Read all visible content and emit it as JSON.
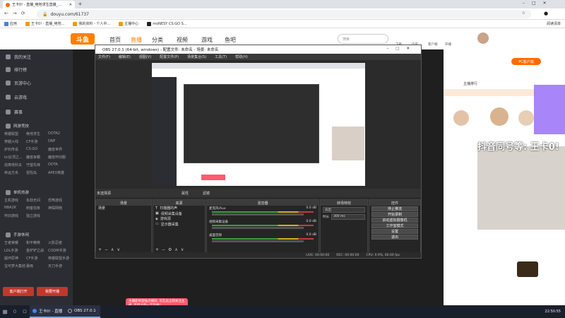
{
  "browser": {
    "tab_title": "王卡0! - 直播_绝地求生直播_...",
    "url": "douyu.com/61737",
    "bookmarks": [
      "应用",
      "王卡0! - 直播_绝地...",
      "我的资料 - 个人中...",
      "主播中心",
      "moNESY CS:GO S..."
    ],
    "bookmark_right": "阅读清单"
  },
  "site": {
    "logo": "斗鱼",
    "nav": [
      "首页",
      "直播",
      "分类",
      "视频",
      "游戏",
      "鱼吧"
    ],
    "search_placeholder": "搜索",
    "header_icons": [
      "下载",
      "历史",
      "客户端",
      "开播"
    ]
  },
  "sidebar": {
    "items": [
      "我的关注",
      "排行榜",
      "页游中心",
      "云游戏",
      "赛事"
    ],
    "sections": [
      {
        "title": "网游竞技",
        "links": [
          "英雄联盟",
          "绝地求生",
          "DOTA2",
          "穿越火线",
          "CF手游",
          "DNF",
          "炉石传说",
          "CS:GO",
          "魔兽世界",
          "lol云顶之...",
          "魔兽争霸",
          "魔兽怀旧服",
          "逃离塔科夫",
          "守望先锋",
          "DOTA",
          "命运方舟",
          "冒险岛",
          "APEX英雄"
        ]
      },
      {
        "title": "单机热游",
        "links": [
          "主机游戏",
          "永劫无间",
          "恐怖游戏",
          "NBA2K",
          "刺客信条",
          "神探网络",
          "怀旧游戏",
          "独立游戏"
        ]
      },
      {
        "title": "手游休闲",
        "links": [
          "王者荣耀",
          "和平精英",
          "火影忍者",
          "LOL手游",
          "金铲铲之战",
          "CODM手游",
          "崩坏原神",
          "CF手游",
          "英雄联盟手游",
          "宝可梦大集结",
          "暴雨",
          "天刀手游"
        ]
      }
    ],
    "buttons": [
      "客户端打开",
      "我要开播"
    ]
  },
  "obs": {
    "title": "OBS 27.0.1 (64-bit, windows) - 配置文件: 未命名 - 场景: 未命名",
    "menu": [
      "文件(F)",
      "编辑(E)",
      "视图(V)",
      "配置文件(P)",
      "场景集合(S)",
      "工具(T)",
      "帮助(H)"
    ],
    "toolbar_label": "未选择源",
    "toolbar_buttons": [
      "属性",
      "滤镜"
    ],
    "panels": {
      "scenes": {
        "title": "场景",
        "items": [
          "场景"
        ]
      },
      "sources": {
        "title": "来源",
        "items": [
          "扫描器的声",
          "视频采集设备",
          "游戏源",
          "显示器采集"
        ]
      },
      "mixer": {
        "title": "混音器",
        "channels": [
          {
            "name": "麦克风/Aux",
            "db": "0.0 dB"
          },
          {
            "name": "视频采集设备",
            "db": "0.0 dB"
          },
          {
            "name": "桌面音频",
            "db": "0.0 dB"
          }
        ]
      },
      "transitions": {
        "title": "转场特效",
        "type": "淡出",
        "duration_label": "时长",
        "duration": "300 ms"
      },
      "controls": {
        "title": "控件",
        "buttons": [
          "停止推流",
          "开始录制",
          "启动虚拟摄像机",
          "工作室模式",
          "设置",
          "退出"
        ]
      }
    },
    "status": [
      "LIVE: 00:00:00",
      "REC: 00:00:00",
      "CPU: 0.9%, 60.00 fps"
    ]
  },
  "stream": {
    "overlay_text": "抖音同号等: 王卡0!",
    "anchor_label": "主播排行",
    "pc_button": "PC客户端",
    "toast": "主播即将登陆点播间, 可在此立即关注主播, 不错过每一次开播!"
  },
  "taskbar": {
    "items": [
      "王卡0! - 直播_绝地求...",
      "OBS 27.0.1 (64-bit..."
    ],
    "clock": "22:50:55"
  },
  "colors": {
    "accent": "#ff7f00",
    "sidebar": "#2b2d33",
    "obs_bg": "#2b2b2b"
  }
}
